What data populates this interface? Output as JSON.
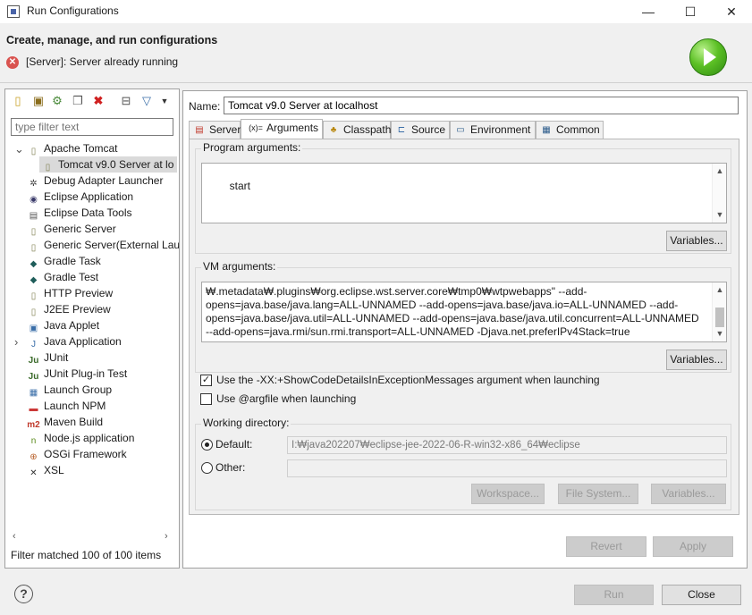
{
  "window": {
    "title": "Run Configurations",
    "minimize": "—",
    "maximize": "☐",
    "close": "✕"
  },
  "header": {
    "title": "Create, manage, and run configurations",
    "error": "[Server]: Server already running"
  },
  "left": {
    "filter_placeholder": "type filter text",
    "tree": [
      {
        "label": "Apache Tomcat",
        "expanded": true,
        "icon": "server-icon"
      },
      {
        "label": "Tomcat v9.0 Server at lo",
        "child": true,
        "selected": true,
        "icon": "server-icon"
      },
      {
        "label": "Debug Adapter Launcher",
        "icon": "debug-adapter-icon"
      },
      {
        "label": "Eclipse Application",
        "icon": "eclipse-icon"
      },
      {
        "label": "Eclipse Data Tools",
        "icon": "data-tools-icon"
      },
      {
        "label": "Generic Server",
        "icon": "server-icon"
      },
      {
        "label": "Generic Server(External Lau",
        "icon": "server-icon"
      },
      {
        "label": "Gradle Task",
        "icon": "gradle-icon"
      },
      {
        "label": "Gradle Test",
        "icon": "gradle-icon"
      },
      {
        "label": "HTTP Preview",
        "icon": "server-icon"
      },
      {
        "label": "J2EE Preview",
        "icon": "server-icon"
      },
      {
        "label": "Java Applet",
        "icon": "applet-icon"
      },
      {
        "label": "Java Application",
        "collapsed": true,
        "icon": "java-app-icon"
      },
      {
        "label": "JUnit",
        "icon": "junit-icon"
      },
      {
        "label": "JUnit Plug-in Test",
        "icon": "junit-icon"
      },
      {
        "label": "Launch Group",
        "icon": "launch-group-icon"
      },
      {
        "label": "Launch NPM",
        "icon": "npm-icon"
      },
      {
        "label": "Maven Build",
        "icon": "maven-icon"
      },
      {
        "label": "Node.js application",
        "icon": "nodejs-icon"
      },
      {
        "label": "OSGi Framework",
        "icon": "osgi-icon"
      },
      {
        "label": "XSL",
        "icon": "xsl-icon"
      }
    ],
    "status": "Filter matched 100 of 100 items"
  },
  "right": {
    "name_label": "Name:",
    "name_value": "Tomcat v9.0 Server at localhost",
    "tabs": [
      {
        "label": "Server",
        "icon": "server-tab-icon"
      },
      {
        "label": "Arguments",
        "icon": "arguments-icon",
        "icon_glyph": "(x)=",
        "active": true
      },
      {
        "label": "Classpath",
        "icon": "classpath-icon"
      },
      {
        "label": "Source",
        "icon": "source-icon"
      },
      {
        "label": "Environment",
        "icon": "environment-icon"
      },
      {
        "label": "Common",
        "icon": "common-icon"
      }
    ],
    "program_args": {
      "label": "Program arguments:",
      "value": "start",
      "variables_btn": "Variables..."
    },
    "vm_args": {
      "label": "VM arguments:",
      "value": "₩.metadata₩.plugins₩org.eclipse.wst.server.core₩tmp0₩wtpwebapps\" --add-opens=java.base/java.lang=ALL-UNNAMED --add-opens=java.base/java.io=ALL-UNNAMED --add-opens=java.base/java.util=ALL-UNNAMED --add-opens=java.base/java.util.concurrent=ALL-UNNAMED --add-opens=java.rmi/sun.rmi.transport=ALL-UNNAMED -Djava.net.preferIPv4Stack=true",
      "lines": [
        "₩.metadata₩.plugins₩org.eclipse.wst.server.core₩tmp0₩wtpwebapps\" --add-",
        "opens=java.base/java.lang=ALL-UNNAMED --add-opens=java.base/java.io=ALL-UNNAMED --add-",
        "opens=java.base/java.util=ALL-UNNAMED --add-opens=java.base/java.util.concurrent=ALL-UNNAMED",
        "--add-opens=java.rmi/sun.rmi.transport=ALL-UNNAMED -Djava.net.preferIPv4Stack=true"
      ],
      "variables_btn": "Variables..."
    },
    "show_code_details": {
      "label": "Use the -XX:+ShowCodeDetailsInExceptionMessages argument when launching",
      "checked": true
    },
    "use_argfile": {
      "label": "Use @argfile when launching",
      "checked": false
    },
    "working_dir": {
      "label": "Working directory:",
      "default_label": "Default:",
      "default_value": "I:₩java202207₩eclipse-jee-2022-06-R-win32-x86_64₩eclipse",
      "other_label": "Other:",
      "other_value": "",
      "workspace_btn": "Workspace...",
      "filesystem_btn": "File System...",
      "variables_btn": "Variables..."
    },
    "revert_btn": "Revert",
    "apply_btn": "Apply"
  },
  "footer": {
    "help": "?",
    "run_btn": "Run",
    "close_btn": "Close"
  }
}
